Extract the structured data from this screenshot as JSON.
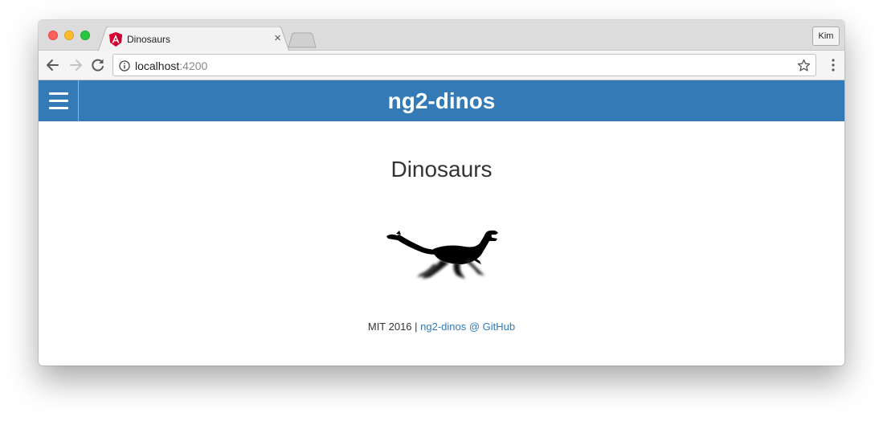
{
  "browser": {
    "tab_title": "Dinosaurs",
    "tab_close": "×",
    "profile": "Kim",
    "url_host": "localhost",
    "url_port": ":4200"
  },
  "app": {
    "title": "ng2-dinos",
    "accent_color": "#337ab7"
  },
  "main": {
    "heading": "Dinosaurs",
    "image_icon": "running-dinosaur-silhouette"
  },
  "footer": {
    "text": "MIT 2016 | ",
    "link_label": "ng2-dinos @ GitHub"
  }
}
